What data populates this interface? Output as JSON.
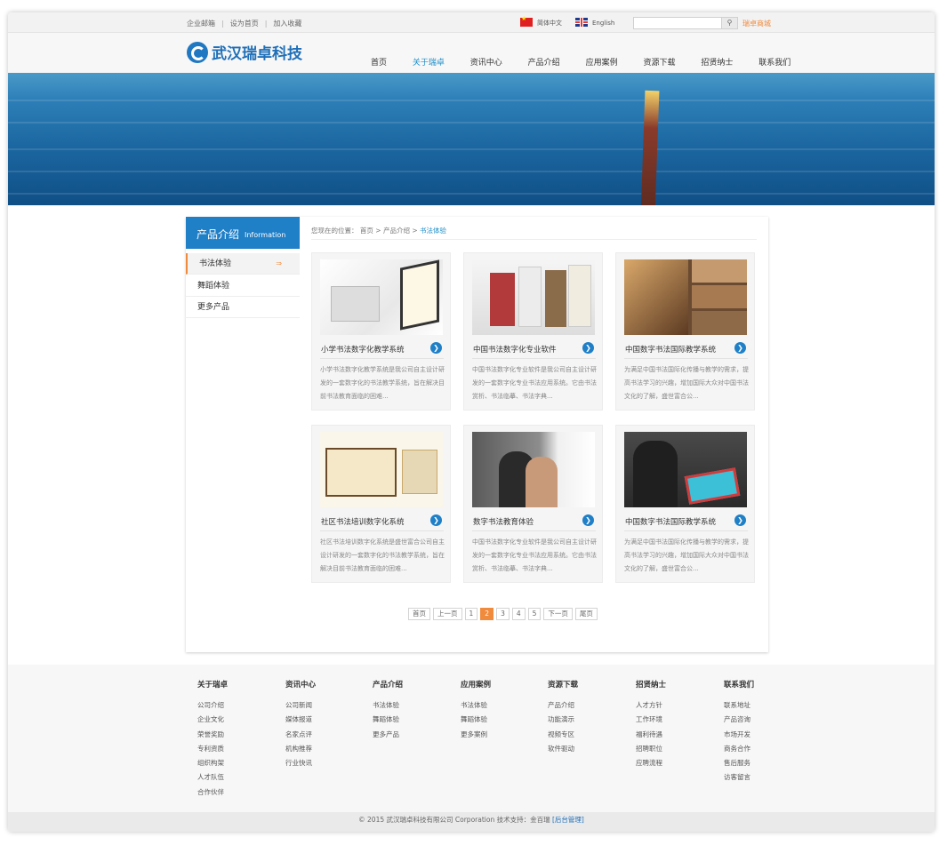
{
  "topbar": {
    "links": [
      "企业邮箱",
      "设为首页",
      "加入收藏"
    ],
    "lang_cn": "简体中文",
    "lang_en": "English",
    "search_placeholder": "",
    "mall": "瑞卓商城"
  },
  "logo": {
    "text": "武汉瑞卓科技"
  },
  "nav": {
    "items": [
      "首页",
      "关于瑞卓",
      "资讯中心",
      "产品介绍",
      "应用案例",
      "资源下载",
      "招贤纳士",
      "联系我们"
    ],
    "active_index": 1
  },
  "sidebar": {
    "title": "产品介绍",
    "title_en": "Information",
    "items": [
      "书法体验",
      "舞蹈体验",
      "更多产品"
    ],
    "active_index": 0
  },
  "breadcrumb": {
    "prefix": "您现在的位置：",
    "items": [
      "首页",
      "产品介绍",
      "书法体验"
    ]
  },
  "products": [
    {
      "title": "小学书法数字化教学系统",
      "desc": "小学书法数字化教学系统是我公司自主设计研发的一套数字化的书法教学系统，旨在解决目前书法教育面临的困难..."
    },
    {
      "title": "中国书法数字化专业软件",
      "desc": "中国书法数字化专业软件是我公司自主设计研发的一套数字化专业书法应用系统。它由书法赏析、书法临摹、书法字典..."
    },
    {
      "title": "中国数字书法国际教学系统",
      "desc": "为满足中国书法国际化传播与教学的需求，提高书法学习的兴趣，增加国际大众对中国书法文化的了解，盛世富合公..."
    },
    {
      "title": "社区书法培训数字化系统",
      "desc": "社区书法培训数字化系统是盛世富合公司自主设计研发的一套数字化的书法教学系统，旨在解决目前书法教育面临的困难..."
    },
    {
      "title": "数字书法教育体验",
      "desc": "中国书法数字化专业软件是我公司自主设计研发的一套数字化专业书法应用系统。它由书法赏析、书法临摹、书法字典..."
    },
    {
      "title": "中国数字书法国际教学系统",
      "desc": "为满足中国书法国际化传播与教学的需求，提高书法学习的兴趣，增加国际大众对中国书法文化的了解，盛世富合公..."
    }
  ],
  "pager": {
    "items": [
      "首页",
      "上一页",
      "1",
      "2",
      "3",
      "4",
      "5",
      "下一页",
      "尾页"
    ],
    "current": "2"
  },
  "footer": {
    "columns": [
      {
        "title": "关于瑞卓",
        "items": [
          "公司介绍",
          "企业文化",
          "荣誉奖励",
          "专利资质",
          "组织构架",
          "人才队伍",
          "合作伙伴"
        ]
      },
      {
        "title": "资讯中心",
        "items": [
          "公司新闻",
          "媒体报道",
          "名家点评",
          "机构推荐",
          "行业快讯"
        ]
      },
      {
        "title": "产品介绍",
        "items": [
          "书法体验",
          "舞蹈体验",
          "更多产品"
        ]
      },
      {
        "title": "应用案例",
        "items": [
          "书法体验",
          "舞蹈体验",
          "更多案例"
        ]
      },
      {
        "title": "资源下载",
        "items": [
          "产品介绍",
          "功能演示",
          "视频专区",
          "软件驱动"
        ]
      },
      {
        "title": "招贤纳士",
        "items": [
          "人才方针",
          "工作环境",
          "福利待遇",
          "招聘职位",
          "应聘流程"
        ]
      },
      {
        "title": "联系我们",
        "items": [
          "联系地址",
          "产品咨询",
          "市场开发",
          "商务合作",
          "售后服务",
          "访客留言"
        ]
      }
    ],
    "copyright": "© 2015 武汉瑞卓科技有限公司 Corporation 技术支持：金百瑞",
    "admin_link": "[后台管理]"
  },
  "colors": {
    "accent_blue": "#1f7fc7",
    "accent_orange": "#f08a3c"
  }
}
